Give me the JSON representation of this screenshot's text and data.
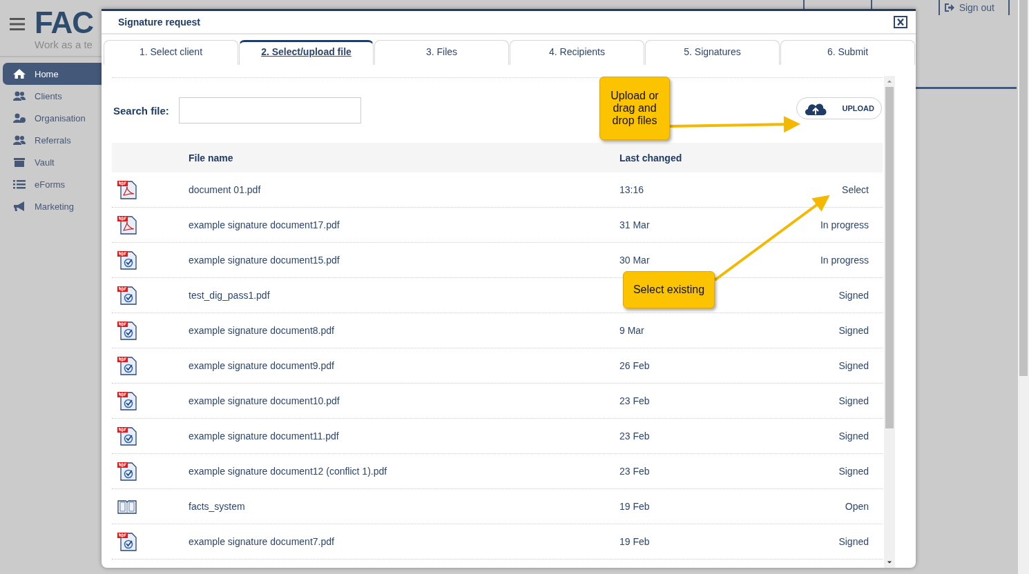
{
  "app": {
    "logo": "FAC",
    "tagline": "Work as a te",
    "nav": [
      {
        "label": "Home",
        "selected": true
      },
      {
        "label": "Clients",
        "selected": false
      },
      {
        "label": "Organisation",
        "selected": false
      },
      {
        "label": "Referrals",
        "selected": false
      },
      {
        "label": "Vault",
        "selected": false
      },
      {
        "label": "eForms",
        "selected": false
      },
      {
        "label": "Marketing",
        "selected": false
      }
    ],
    "sign_out": "Sign out"
  },
  "dialog": {
    "title": "Signature request",
    "tabs": [
      {
        "label": "1. Select client",
        "selected": false
      },
      {
        "label": "2. Select/upload file",
        "selected": true
      },
      {
        "label": "3. Files",
        "selected": false
      },
      {
        "label": "4. Recipients",
        "selected": false
      },
      {
        "label": "5. Signatures",
        "selected": false
      },
      {
        "label": "6. Submit",
        "selected": false
      }
    ],
    "search": {
      "label": "Search file:"
    },
    "upload_button": "UPLOAD",
    "columns": [
      "File name",
      "Last changed"
    ],
    "rows": [
      {
        "kind": "adobe",
        "name": "document 01.pdf",
        "date": "13:16",
        "status": "Select"
      },
      {
        "kind": "adobe",
        "name": "example signature document17.pdf",
        "date": "31 Mar",
        "status": "In progress"
      },
      {
        "kind": "signed",
        "name": "example signature document15.pdf",
        "date": "30 Mar",
        "status": "In progress"
      },
      {
        "kind": "signed",
        "name": "test_dig_pass1.pdf",
        "status": "Signed"
      },
      {
        "kind": "signed",
        "name": "example signature document8.pdf",
        "date": "9 Mar",
        "status": "Signed"
      },
      {
        "kind": "signed",
        "name": "example signature document9.pdf",
        "date": "26 Feb",
        "status": "Signed"
      },
      {
        "kind": "signed",
        "name": "example signature document10.pdf",
        "date": "23 Feb",
        "status": "Signed"
      },
      {
        "kind": "signed",
        "name": "example signature document11.pdf",
        "date": "23 Feb",
        "status": "Signed"
      },
      {
        "kind": "signed",
        "name": "example signature document12 (conflict 1).pdf",
        "date": "23 Feb",
        "status": "Signed"
      },
      {
        "kind": "folder",
        "name": "facts_system",
        "date": "19 Feb",
        "status": "Open"
      },
      {
        "kind": "signed",
        "name": "example signature document7.pdf",
        "date": "19 Feb",
        "status": "Signed"
      }
    ]
  },
  "callouts": [
    "Upload or drag and drop files",
    "Select existing"
  ]
}
